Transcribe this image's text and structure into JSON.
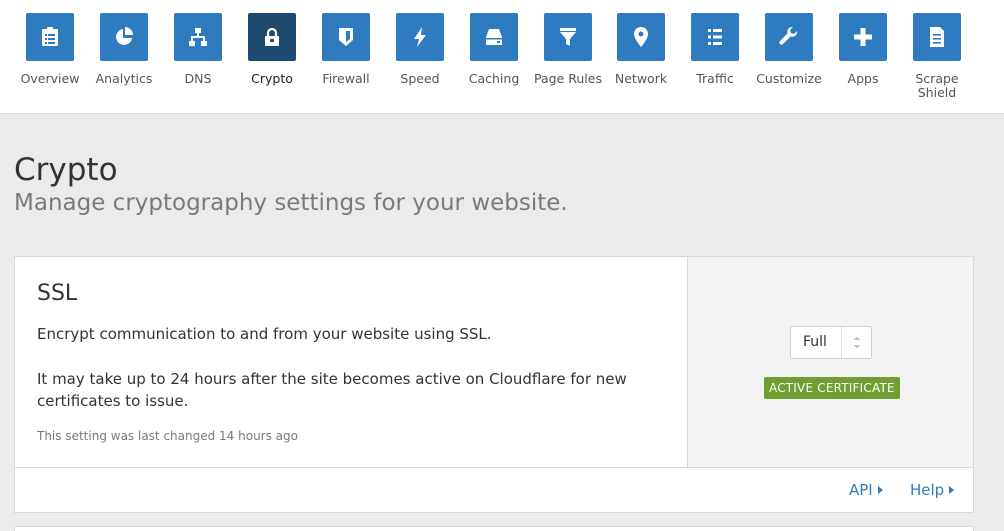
{
  "nav": {
    "items": [
      {
        "label": "Overview",
        "icon": "clipboard-icon"
      },
      {
        "label": "Analytics",
        "icon": "pie-chart-icon"
      },
      {
        "label": "DNS",
        "icon": "network-tree-icon"
      },
      {
        "label": "Crypto",
        "icon": "lock-icon",
        "active": true
      },
      {
        "label": "Firewall",
        "icon": "shield-icon"
      },
      {
        "label": "Speed",
        "icon": "lightning-icon"
      },
      {
        "label": "Caching",
        "icon": "hard-drive-icon"
      },
      {
        "label": "Page Rules",
        "icon": "filter-icon"
      },
      {
        "label": "Network",
        "icon": "map-pin-icon"
      },
      {
        "label": "Traffic",
        "icon": "list-icon"
      },
      {
        "label": "Customize",
        "icon": "wrench-icon"
      },
      {
        "label": "Apps",
        "icon": "plus-icon"
      },
      {
        "label": "Scrape Shield",
        "icon": "document-icon"
      }
    ]
  },
  "page": {
    "title": "Crypto",
    "subtitle": "Manage cryptography settings for your website."
  },
  "ssl_card": {
    "title": "SSL",
    "description": "Encrypt communication to and from your website using SSL.",
    "note": "It may take up to 24 hours after the site becomes active on Cloudflare for new certificates to issue.",
    "last_changed": "This setting was last changed 14 hours ago",
    "select_value": "Full",
    "status_badge": "ACTIVE CERTIFICATE",
    "api_link": "API",
    "help_link": "Help"
  },
  "colors": {
    "nav_tile": "#2f7bbf",
    "nav_tile_active": "#1f4a70",
    "badge_green": "#6e9f30",
    "link_blue": "#2f7bbf",
    "page_background": "#ebebeb"
  }
}
